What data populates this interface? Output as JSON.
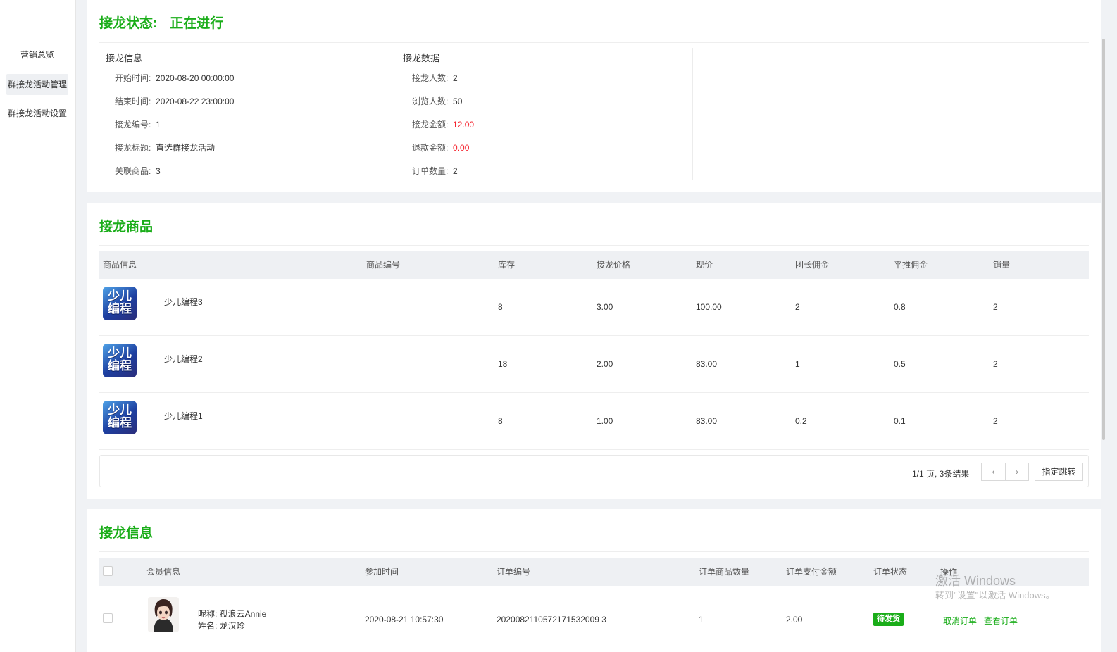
{
  "sidebar": {
    "items": [
      {
        "label": "营销总览"
      },
      {
        "label": "群接龙活动管理"
      },
      {
        "label": "群接龙活动设置"
      }
    ]
  },
  "status": {
    "label": "接龙状态:",
    "value": "正在进行",
    "info": {
      "heading": "接龙信息",
      "rows": [
        {
          "key": "开始时间:",
          "value": "2020-08-20 00:00:00"
        },
        {
          "key": "结束时间:",
          "value": "2020-08-22 23:00:00"
        },
        {
          "key": "接龙编号:",
          "value": "1"
        },
        {
          "key": "接龙标题:",
          "value": "直选群接龙活动"
        },
        {
          "key": "关联商品:",
          "value": "3"
        }
      ]
    },
    "stats": {
      "heading": "接龙数据",
      "rows": [
        {
          "key": "接龙人数:",
          "value": "2"
        },
        {
          "key": "浏览人数:",
          "value": "50"
        },
        {
          "key": "接龙金额:",
          "value": "12.00"
        },
        {
          "key": "退款金额:",
          "value": "0.00"
        },
        {
          "key": "订单数量:",
          "value": "2"
        }
      ]
    }
  },
  "products": {
    "title": "接龙商品",
    "columns": [
      "商品信息",
      "商品编号",
      "库存",
      "接龙价格",
      "现价",
      "团长佣金",
      "平推佣金",
      "销量"
    ],
    "thumb": {
      "line1": "少儿",
      "line2": "编程"
    },
    "rows": [
      {
        "name": "少儿编程3",
        "code": "",
        "stock": "8",
        "price": "3.00",
        "current": "100.00",
        "leader": "2",
        "push": "0.8",
        "sales": "2"
      },
      {
        "name": "少儿编程2",
        "code": "",
        "stock": "18",
        "price": "2.00",
        "current": "83.00",
        "leader": "1",
        "push": "0.5",
        "sales": "2"
      },
      {
        "name": "少儿编程1",
        "code": "",
        "stock": "8",
        "price": "1.00",
        "current": "83.00",
        "leader": "0.2",
        "push": "0.1",
        "sales": "2"
      }
    ],
    "pager": {
      "summary": "1/1 页, 3条结果",
      "prev": "‹",
      "next": "›",
      "jump": "指定跳转"
    }
  },
  "orders": {
    "title": "接龙信息",
    "columns": [
      "会员信息",
      "参加时间",
      "订单编号",
      "订单商品数量",
      "订单支付金额",
      "订单状态",
      "操作"
    ],
    "rows": [
      {
        "nickname": "昵称: 孤浪云Annie",
        "realname": "姓名: 龙汉珍",
        "time": "2020-08-21 10:57:30",
        "order_no": "2020082110572171532009 3",
        "qty": "1",
        "amount": "2.00",
        "status": "待发货",
        "actions": [
          "取消订单",
          "查看订单"
        ]
      }
    ]
  },
  "watermark": {
    "line1": "激活 Windows",
    "line2": "转到\"设置\"以激活 Windows。"
  },
  "colors": {
    "accent": "#1aad19",
    "red": "#f5222d"
  }
}
